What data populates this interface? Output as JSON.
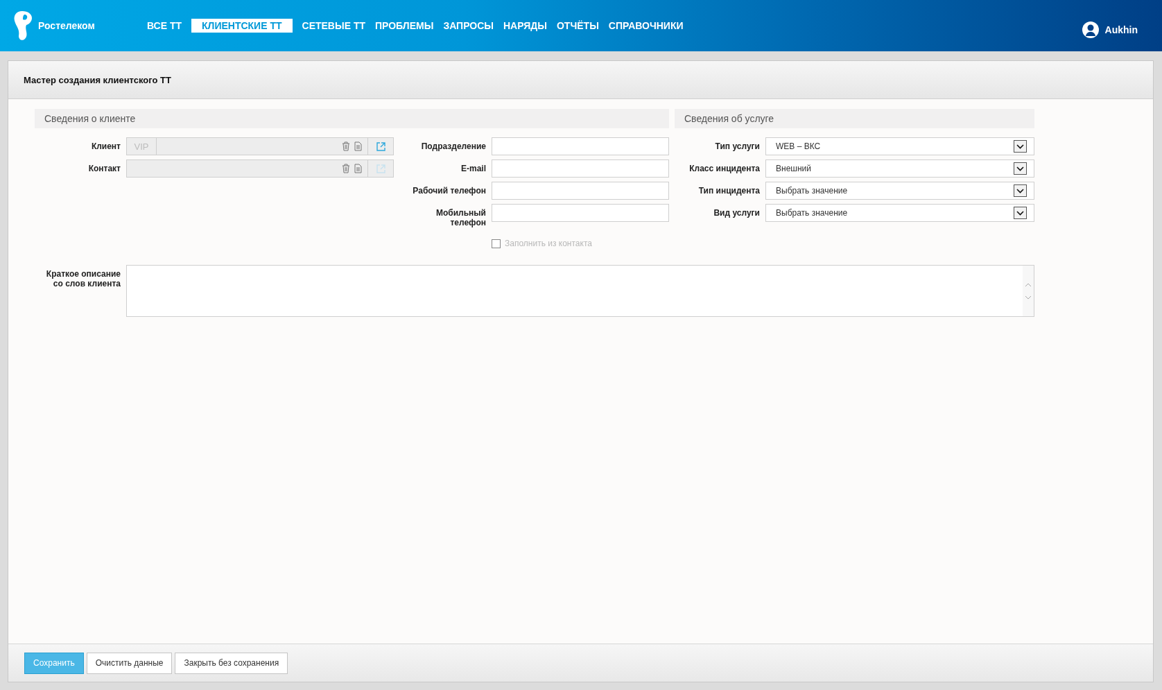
{
  "header": {
    "brand": "Ростелеком",
    "nav": [
      {
        "label": "ВСЕ ТТ",
        "selected": false
      },
      {
        "label": "КЛИЕНТСКИЕ ТТ",
        "selected": true
      },
      {
        "label": "СЕТЕВЫЕ ТТ",
        "selected": false
      },
      {
        "label": "ПРОБЛЕМЫ",
        "selected": false
      },
      {
        "label": "ЗАПРОСЫ",
        "selected": false
      },
      {
        "label": "НАРЯДЫ",
        "selected": false
      },
      {
        "label": "ОТЧЁТЫ",
        "selected": false
      },
      {
        "label": "СПРАВОЧНИКИ",
        "selected": false
      }
    ],
    "user": "Aukhin"
  },
  "form_title": "Мастер создания клиентского ТТ",
  "client_section": {
    "title": "Сведения о клиенте",
    "fields": [
      {
        "label": "Клиент",
        "badge": "VIP",
        "link_enabled": true
      },
      {
        "label": "Контакт",
        "link_enabled": false
      }
    ]
  },
  "contact_fields": [
    {
      "label": "Подразделение"
    },
    {
      "label": "E-mail"
    },
    {
      "label": "Рабочий телефон"
    },
    {
      "label": "Мобильный\nтелефон"
    }
  ],
  "fill_from_contact": {
    "label": "Заполнить из контакта",
    "checked": false,
    "disabled": true
  },
  "service_section": {
    "title": "Сведения об услуге",
    "selects": [
      {
        "label": "Тип услуги",
        "value": "WEB – ВКС"
      },
      {
        "label": "Класс инцидента",
        "value": "Внешний"
      },
      {
        "label": "Тип инцидента",
        "value": "Выбрать значение"
      },
      {
        "label": "Вид услуги",
        "value": "Выбрать значение"
      }
    ]
  },
  "description": {
    "label": "Краткое описание\nсо слов клиента"
  },
  "buttons": [
    {
      "label": "Сохранить",
      "primary": true
    },
    {
      "label": "Очистить данные",
      "primary": false
    },
    {
      "label": "Закрыть без сохранения",
      "primary": false
    }
  ]
}
